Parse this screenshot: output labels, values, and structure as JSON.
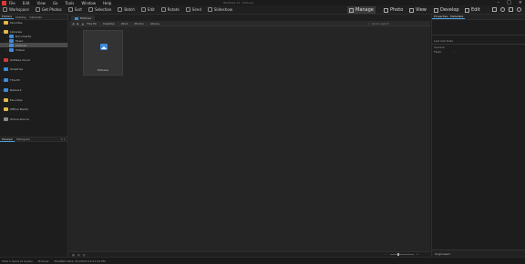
{
  "titlebar": {
    "title": "Windows 11 - Pictures",
    "menus": [
      "File",
      "Edit",
      "View",
      "Go",
      "Tools",
      "Window",
      "Help"
    ],
    "window_controls": [
      "–",
      "□",
      "×"
    ]
  },
  "toolbar": {
    "items": [
      "Workspace",
      "Get Photos",
      "Sort",
      "Selection",
      "Batch",
      "Edit",
      "Rotate",
      "Send",
      "Slideshow"
    ],
    "modes": [
      {
        "label": "Manage",
        "active": true
      },
      {
        "label": "Photo",
        "active": false
      },
      {
        "label": "View",
        "active": false
      },
      {
        "label": "Develop",
        "active": false
      },
      {
        "label": "Edit",
        "active": false
      }
    ]
  },
  "left_panel": {
    "tabs": [
      "Folders",
      "Catalog",
      "Calendar"
    ],
    "tree": [
      {
        "label": "Favorites",
        "icon": "folder",
        "arrow": "›"
      },
      {
        "label": "Libraries",
        "icon": "folder",
        "arrow": "⌄"
      },
      {
        "label": "Documents",
        "icon": "blue",
        "arrow": "›"
      },
      {
        "label": "Music",
        "icon": "blue",
        "arrow": "›"
      },
      {
        "label": "Pictures",
        "icon": "blue",
        "arrow": "›",
        "selected": true
      },
      {
        "label": "Videos",
        "icon": "blue",
        "arrow": "›"
      },
      {
        "label": "ACDSee Cloud",
        "icon": "red",
        "arrow": ""
      },
      {
        "label": "OneDrive",
        "icon": "blue",
        "arrow": "›"
      },
      {
        "label": "This PC",
        "icon": "blue",
        "arrow": "›"
      },
      {
        "label": "Network",
        "icon": "blue",
        "arrow": "›"
      },
      {
        "label": "Favorites",
        "icon": "folder",
        "arrow": "›"
      },
      {
        "label": "Offline Media",
        "icon": "folder",
        "arrow": ""
      },
      {
        "label": "Online Source",
        "icon": "grey",
        "arrow": ""
      }
    ],
    "preview": {
      "tab1": "Preview",
      "tab2": "Histogram",
      "controls": "▾ ×"
    }
  },
  "main": {
    "doc_tab": "Pictures",
    "breadcrumb": [
      "This PC",
      "Desktop",
      "Work",
      "Photos",
      "Library"
    ],
    "search_placeholder": "Quick search",
    "thumbnail": {
      "label": "Pictures"
    }
  },
  "right_panel": {
    "header": "Properties - Metadata",
    "section": "Last Cell Data",
    "rows": [
      {
        "key": "Camera",
        "value": ""
      },
      {
        "key": "Flash",
        "value": "–"
      }
    ],
    "footer": "Ungrouped"
  },
  "statusbar": {
    "total": "Total 1 items (0 bytes)",
    "folder": "Pictures",
    "modified": "Modified Date: 8/1/2023 10:11:52 PM"
  }
}
